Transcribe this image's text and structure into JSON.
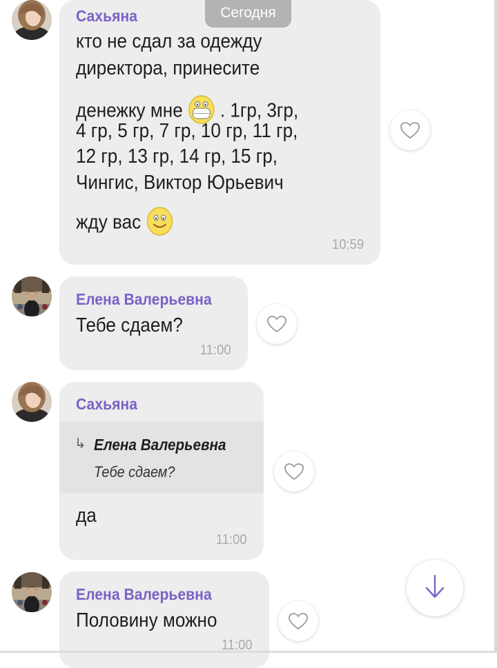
{
  "date_chip": "Сегодня",
  "messages": [
    {
      "sender": "Сахьяна",
      "lines": [
        "кто не сдал  за одежду",
        "директора, принесите",
        "денежку  мне",
        ". 1гр, 3гр,",
        "4 гр, 5 гр, 7 гр, 10 гр, 11 гр,",
        "12 гр, 13 гр, 14 гр, 15 гр,",
        "Чингис, Виктор Юрьевич",
        "жду вас"
      ],
      "time": "10:59",
      "emoji_1": "grinning-face-emoji",
      "emoji_2": "smiling-face-emoji"
    },
    {
      "sender": "Елена Валерьевна",
      "text": "Тебе сдаем?",
      "time": "11:00"
    },
    {
      "sender": "Сахьяна",
      "reply": {
        "name": "Елена Валерьевна",
        "text": "Тебе сдаем?",
        "arrow": "↳"
      },
      "text": "да",
      "time": "11:00"
    },
    {
      "sender": "Елена Валерьевна",
      "text": "Половину можно",
      "time": "11:00"
    }
  ],
  "icons": {
    "like": "heart-icon",
    "scroll": "arrow-down-icon"
  },
  "colors": {
    "sender": "#7b61c6",
    "bubble": "#ededed",
    "time": "#a9a9a9"
  }
}
